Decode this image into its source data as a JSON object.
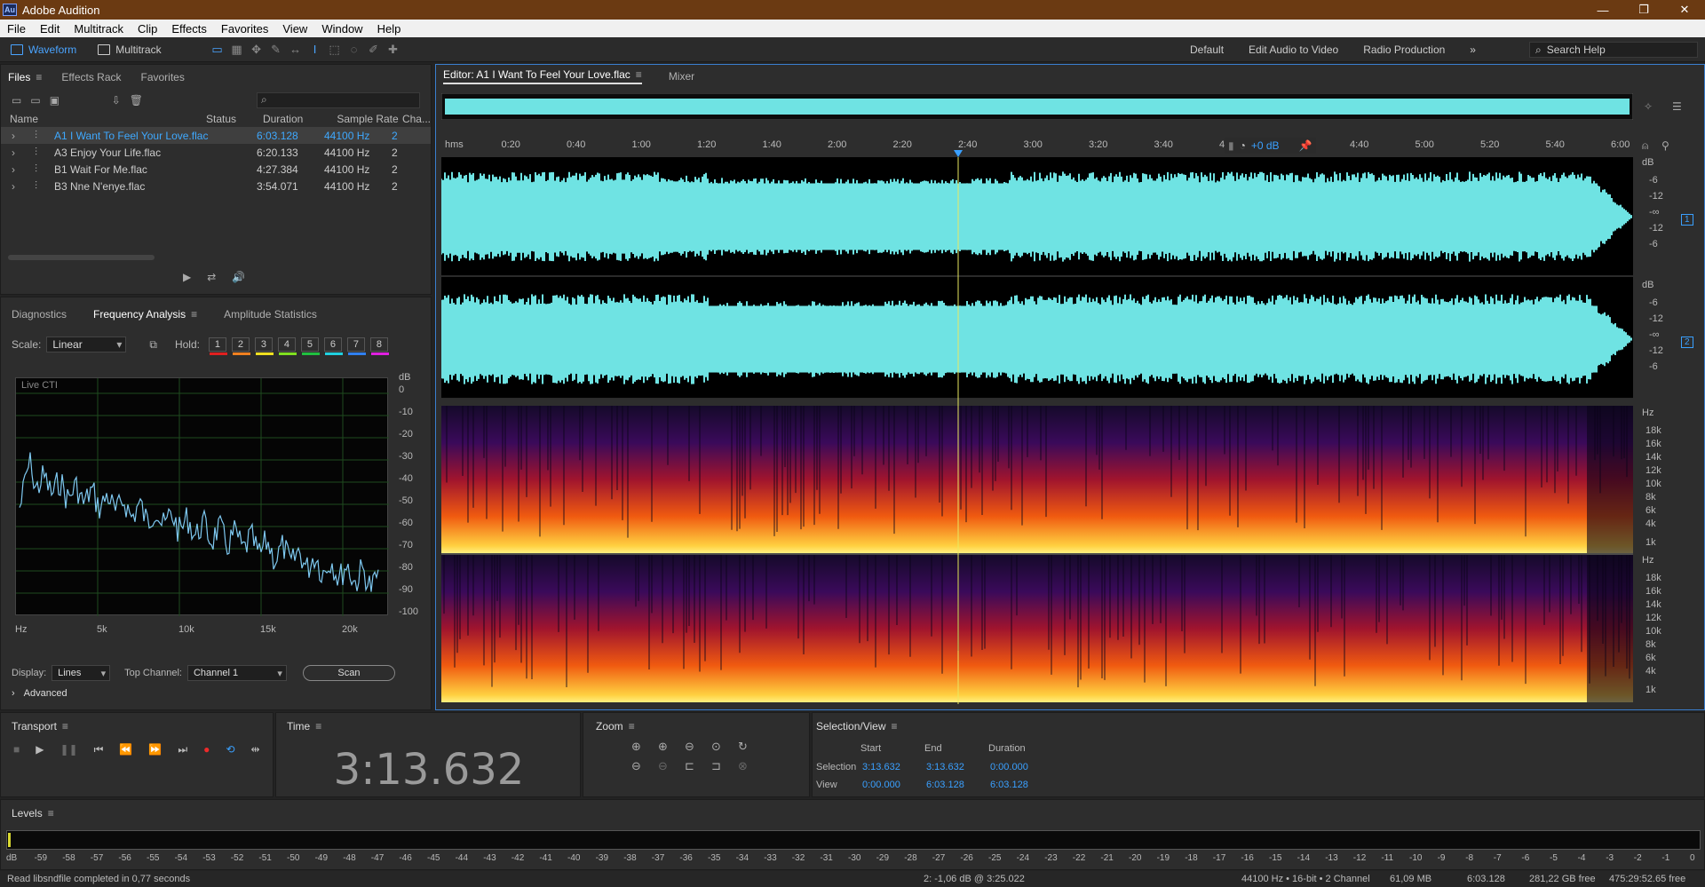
{
  "window": {
    "title": "Adobe Audition",
    "logo": "Au"
  },
  "menu": [
    "File",
    "Edit",
    "Multitrack",
    "Clip",
    "Effects",
    "Favorites",
    "View",
    "Window",
    "Help"
  ],
  "toolbar": {
    "waveform": "Waveform",
    "multitrack": "Multitrack",
    "workspaces": [
      "Default",
      "Edit Audio to Video",
      "Radio Production"
    ],
    "search_placeholder": "Search Help"
  },
  "files_panel": {
    "tabs": [
      "Files",
      "Effects Rack",
      "Favorites"
    ],
    "columns": [
      "Name",
      "Status",
      "Duration",
      "Sample Rate",
      "Cha..."
    ],
    "rows": [
      {
        "name": "A1 I Want To Feel Your Love.flac",
        "status": "",
        "duration": "6:03.128",
        "rate": "44100 Hz",
        "ch": "2",
        "selected": true
      },
      {
        "name": "A3 Enjoy Your Life.flac",
        "status": "",
        "duration": "6:20.133",
        "rate": "44100 Hz",
        "ch": "2",
        "selected": false
      },
      {
        "name": "B1 Wait For Me.flac",
        "status": "",
        "duration": "4:27.384",
        "rate": "44100 Hz",
        "ch": "2",
        "selected": false
      },
      {
        "name": "B3 Nne N'enye.flac",
        "status": "",
        "duration": "3:54.071",
        "rate": "44100 Hz",
        "ch": "2",
        "selected": false
      }
    ]
  },
  "analysis_panel": {
    "tabs": [
      "Diagnostics",
      "Frequency Analysis",
      "Amplitude Statistics"
    ],
    "scale_label": "Scale:",
    "scale_value": "Linear",
    "hold_label": "Hold:",
    "hold": [
      {
        "n": "1",
        "c": "#e02020"
      },
      {
        "n": "2",
        "c": "#f08020"
      },
      {
        "n": "3",
        "c": "#f0e020"
      },
      {
        "n": "4",
        "c": "#80e020"
      },
      {
        "n": "5",
        "c": "#20c040"
      },
      {
        "n": "6",
        "c": "#20d0e0"
      },
      {
        "n": "7",
        "c": "#3080f0"
      },
      {
        "n": "8",
        "c": "#e020e0"
      }
    ],
    "live_label": "Live CTI",
    "db_label": "dB",
    "db_ticks": [
      "0",
      "-10",
      "-20",
      "-30",
      "-40",
      "-50",
      "-60",
      "-70",
      "-80",
      "-90",
      "-100"
    ],
    "hz_ticks": [
      "Hz",
      "5k",
      "10k",
      "15k",
      "20k"
    ],
    "display_label": "Display:",
    "display_value": "Lines",
    "top_channel_label": "Top Channel:",
    "top_channel_value": "Channel 1",
    "scan": "Scan",
    "advanced": "Advanced"
  },
  "editor": {
    "tab": "Editor: A1 I Want To Feel Your Love.flac",
    "mixer": "Mixer",
    "ruler": [
      "hms",
      "0:20",
      "0:40",
      "1:00",
      "1:20",
      "1:40",
      "2:00",
      "2:20",
      "2:40",
      "3:00",
      "3:20",
      "3:40",
      "4:00",
      "4:20",
      "4:40",
      "5:00",
      "5:20",
      "5:40",
      "6:00"
    ],
    "gain": "+0 dB",
    "db_scale": [
      "dB",
      "-6",
      "-12",
      "-∞",
      "-12",
      "-6"
    ],
    "hz_scale": [
      "Hz",
      "18k",
      "16k",
      "14k",
      "12k",
      "10k",
      "8k",
      "6k",
      "4k",
      "1k"
    ],
    "ch1": "1",
    "ch2": "2"
  },
  "transport": {
    "title": "Transport"
  },
  "time": {
    "title": "Time",
    "value": "3:13.632"
  },
  "zoom": {
    "title": "Zoom"
  },
  "selection": {
    "title": "Selection/View",
    "cols": [
      "Start",
      "End",
      "Duration"
    ],
    "rows": [
      {
        "label": "Selection",
        "start": "3:13.632",
        "end": "3:13.632",
        "dur": "0:00.000"
      },
      {
        "label": "View",
        "start": "0:00.000",
        "end": "6:03.128",
        "dur": "6:03.128"
      }
    ]
  },
  "levels": {
    "title": "Levels",
    "ticks": [
      "dB",
      "-59",
      "-58",
      "-57",
      "-56",
      "-55",
      "-54",
      "-53",
      "-52",
      "-51",
      "-50",
      "-49",
      "-48",
      "-47",
      "-46",
      "-45",
      "-44",
      "-43",
      "-42",
      "-41",
      "-40",
      "-39",
      "-38",
      "-37",
      "-36",
      "-35",
      "-34",
      "-33",
      "-32",
      "-31",
      "-30",
      "-29",
      "-28",
      "-27",
      "-26",
      "-25",
      "-24",
      "-23",
      "-22",
      "-21",
      "-20",
      "-19",
      "-18",
      "-17",
      "-16",
      "-15",
      "-14",
      "-13",
      "-12",
      "-11",
      "-10",
      "-9",
      "-8",
      "-7",
      "-6",
      "-5",
      "-4",
      "-3",
      "-2",
      "-1",
      "0"
    ]
  },
  "status": {
    "left": "Read libsndfile completed in 0,77 seconds",
    "cursor": "2: -1,06 dB @ 3:25.022",
    "format": "44100 Hz • 16-bit • 2 Channel",
    "size": "61,09 MB",
    "dur": "6:03.128",
    "free": "281,22 GB free",
    "freetime": "475:29:52.65 free"
  },
  "colors": {
    "accent": "#3aa0ff",
    "waveform": "#6fe3e3",
    "playhead": "#e8e860"
  }
}
